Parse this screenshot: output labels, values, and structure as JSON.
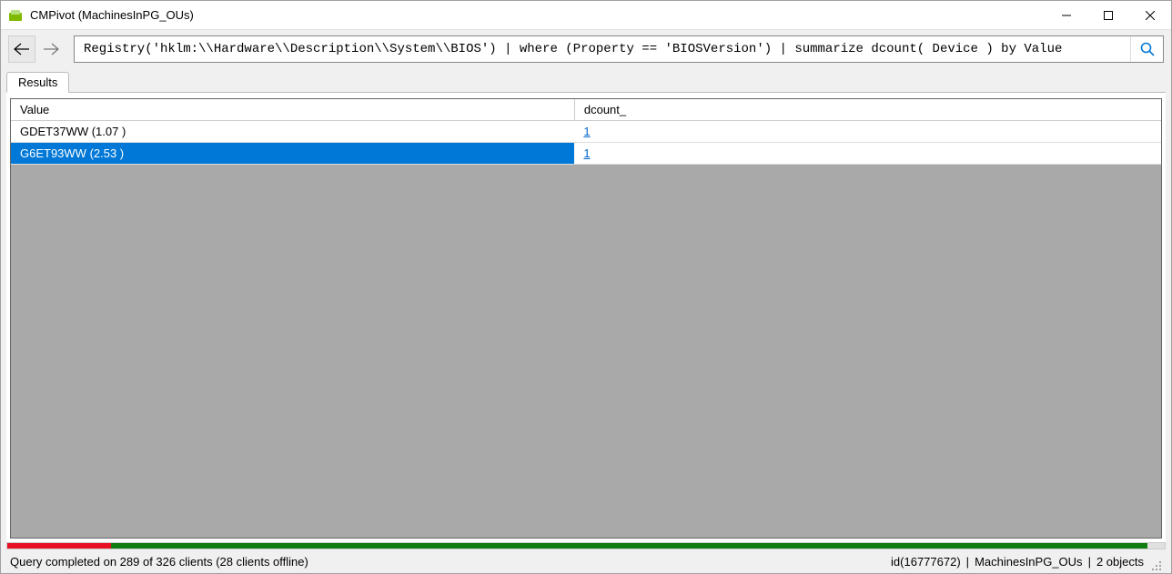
{
  "window": {
    "title": "CMPivot (MachinesInPG_OUs)"
  },
  "toolbar": {
    "query": "Registry('hklm:\\\\Hardware\\\\Description\\\\System\\\\BIOS') | where (Property == 'BIOSVersion') | summarize dcount( Device ) by Value"
  },
  "tabs": {
    "results_label": "Results"
  },
  "grid": {
    "columns": {
      "value": "Value",
      "dcount": "dcount_"
    },
    "rows": [
      {
        "value": "GDET37WW (1.07 )",
        "dcount": "1",
        "selected": false
      },
      {
        "value": "G6ET93WW (2.53 )",
        "dcount": "1",
        "selected": true
      }
    ]
  },
  "status": {
    "left": "Query completed on 289 of 326 clients (28 clients offline)",
    "id": "id(16777672)",
    "collection": "MachinesInPG_OUs",
    "objects": "2 objects"
  }
}
